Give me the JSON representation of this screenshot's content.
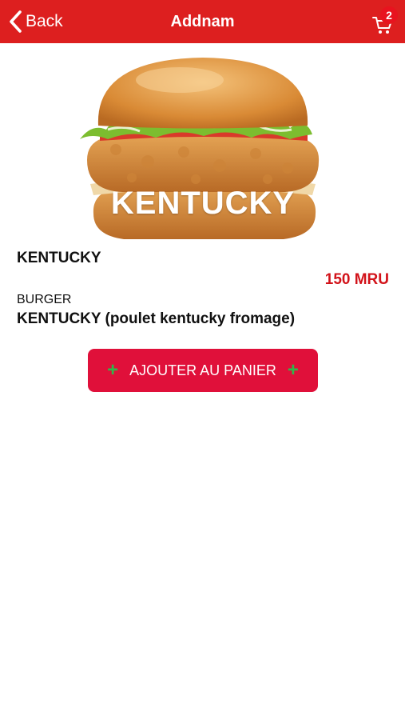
{
  "header": {
    "back_label": "Back",
    "title": "Addnam",
    "cart_count": "2",
    "background_color": "#dd1f1f"
  },
  "product": {
    "image_caption": "KENTUCKY",
    "name": "KENTUCKY",
    "price": "150 MRU",
    "category": "BURGER",
    "description": "KENTUCKY (poulet kentucky fromage)"
  },
  "actions": {
    "add_to_cart_label": "AJOUTER AU PANIER",
    "plus_symbol": "+",
    "button_color": "#e0103a",
    "plus_color": "#2fb84a"
  },
  "icons": {
    "back": "chevron-left-icon",
    "cart": "cart-icon"
  }
}
